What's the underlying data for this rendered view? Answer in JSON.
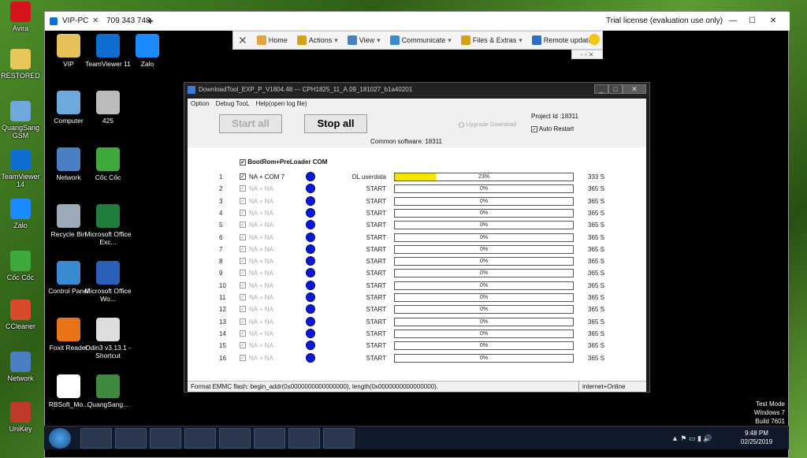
{
  "local_desktop": {
    "icons": [
      {
        "label": "Avira",
        "color": "#d4141a"
      },
      {
        "label": "RESTORED",
        "color": "#e8c65a"
      },
      {
        "label": "QuangSang GSM",
        "color": "#6fa8dc"
      },
      {
        "label": "TeamViewer 14",
        "color": "#0e6fd0"
      },
      {
        "label": "Zalo",
        "color": "#1a8cff"
      },
      {
        "label": "Cốc Cốc",
        "color": "#3eaa3e"
      },
      {
        "label": "CCleaner",
        "color": "#d84a2a"
      },
      {
        "label": "Network",
        "color": "#4a7fc4"
      },
      {
        "label": "UniKey",
        "color": "#c0392b"
      }
    ]
  },
  "teamviewer": {
    "tabs": [
      "VIP-PC",
      "709 343 748"
    ],
    "license_text": "Trial license (evaluation use only)",
    "toolbar": [
      "Home",
      "Actions",
      "View",
      "Communicate",
      "Files & Extras",
      "Remote update"
    ],
    "close_symbol": "✕",
    "add_tab_symbol": "+"
  },
  "remote_desktop": {
    "icons": [
      {
        "label": "VIP",
        "color": "#e6c15a"
      },
      {
        "label": "TeamViewer 11",
        "color": "#0e6fd0"
      },
      {
        "label": "Zalo",
        "color": "#1a8cff"
      },
      {
        "label": "Computer",
        "color": "#6fa8dc"
      },
      {
        "label": "425",
        "color": "#bbbbbb"
      },
      {
        "label": "Network",
        "color": "#4a7fc4"
      },
      {
        "label": "Cốc Cốc",
        "color": "#3eaa3e"
      },
      {
        "label": "Recycle Bin",
        "color": "#9aaab8"
      },
      {
        "label": "Microsoft Office Exc...",
        "color": "#1e7e3e"
      },
      {
        "label": "Control Panel",
        "color": "#3a8ad1"
      },
      {
        "label": "Microsoft Office Wo...",
        "color": "#2b5fb8"
      },
      {
        "label": "Foxit Reader",
        "color": "#e8741a"
      },
      {
        "label": "Odin3 v3.13.1 - Shortcut",
        "color": "#dddddd"
      },
      {
        "label": "RBSoft_Mo...",
        "color": "#ffffff"
      },
      {
        "label": "QuangSang...",
        "color": "#3e8a3e"
      }
    ],
    "watermark": [
      "Test Mode",
      "Windows 7",
      "Build 7601"
    ],
    "clock_time": "9:48 PM",
    "clock_date": "02/25/2019"
  },
  "download_tool": {
    "title": "DownloadTool_EXP_P_V1804.48 --- CPH1825_11_A.09_181027_b1a40201",
    "menu": [
      "Option",
      "Debug TooL",
      "Help(open log file)"
    ],
    "start_all_label": "Start all",
    "stop_all_label": "Stop all",
    "upgrade_download_label": "Upgrade Download",
    "project_id": "Project Id :18311",
    "auto_restart_label": "Auto Restart",
    "common_software": "Common software: 18311",
    "preloader_label": "BootRom+PreLoader COM",
    "rows": [
      {
        "num": "1",
        "port": "NA + COM  7",
        "status": "DL userdata",
        "percent": "23%",
        "progress": 0.23,
        "time": "333 S"
      },
      {
        "num": "2",
        "port": "NA + NA",
        "status": "START",
        "percent": "0%",
        "progress": 0,
        "time": "365 S"
      },
      {
        "num": "3",
        "port": "NA + NA",
        "status": "START",
        "percent": "0%",
        "progress": 0,
        "time": "365 S"
      },
      {
        "num": "4",
        "port": "NA + NA",
        "status": "START",
        "percent": "0%",
        "progress": 0,
        "time": "365 S"
      },
      {
        "num": "5",
        "port": "NA + NA",
        "status": "START",
        "percent": "0%",
        "progress": 0,
        "time": "365 S"
      },
      {
        "num": "6",
        "port": "NA + NA",
        "status": "START",
        "percent": "0%",
        "progress": 0,
        "time": "365 S"
      },
      {
        "num": "7",
        "port": "NA + NA",
        "status": "START",
        "percent": "0%",
        "progress": 0,
        "time": "365 S"
      },
      {
        "num": "8",
        "port": "NA + NA",
        "status": "START",
        "percent": "0%",
        "progress": 0,
        "time": "365 S"
      },
      {
        "num": "9",
        "port": "NA + NA",
        "status": "START",
        "percent": "0%",
        "progress": 0,
        "time": "365 S"
      },
      {
        "num": "10",
        "port": "NA + NA",
        "status": "START",
        "percent": "0%",
        "progress": 0,
        "time": "365 S"
      },
      {
        "num": "11",
        "port": "NA + NA",
        "status": "START",
        "percent": "0%",
        "progress": 0,
        "time": "365 S"
      },
      {
        "num": "12",
        "port": "NA + NA",
        "status": "START",
        "percent": "0%",
        "progress": 0,
        "time": "365 S"
      },
      {
        "num": "13",
        "port": "NA + NA",
        "status": "START",
        "percent": "0%",
        "progress": 0,
        "time": "365 S"
      },
      {
        "num": "14",
        "port": "NA + NA",
        "status": "START",
        "percent": "0%",
        "progress": 0,
        "time": "365 S"
      },
      {
        "num": "15",
        "port": "NA + NA",
        "status": "START",
        "percent": "0%",
        "progress": 0,
        "time": "365 S"
      },
      {
        "num": "16",
        "port": "NA + NA",
        "status": "START",
        "percent": "0%",
        "progress": 0,
        "time": "365 S"
      }
    ],
    "status_left": "Format EMMC flash:  begin_addr(0x0000000000000000), length(0x0000000000000000).",
    "status_right": "internet+Online"
  }
}
